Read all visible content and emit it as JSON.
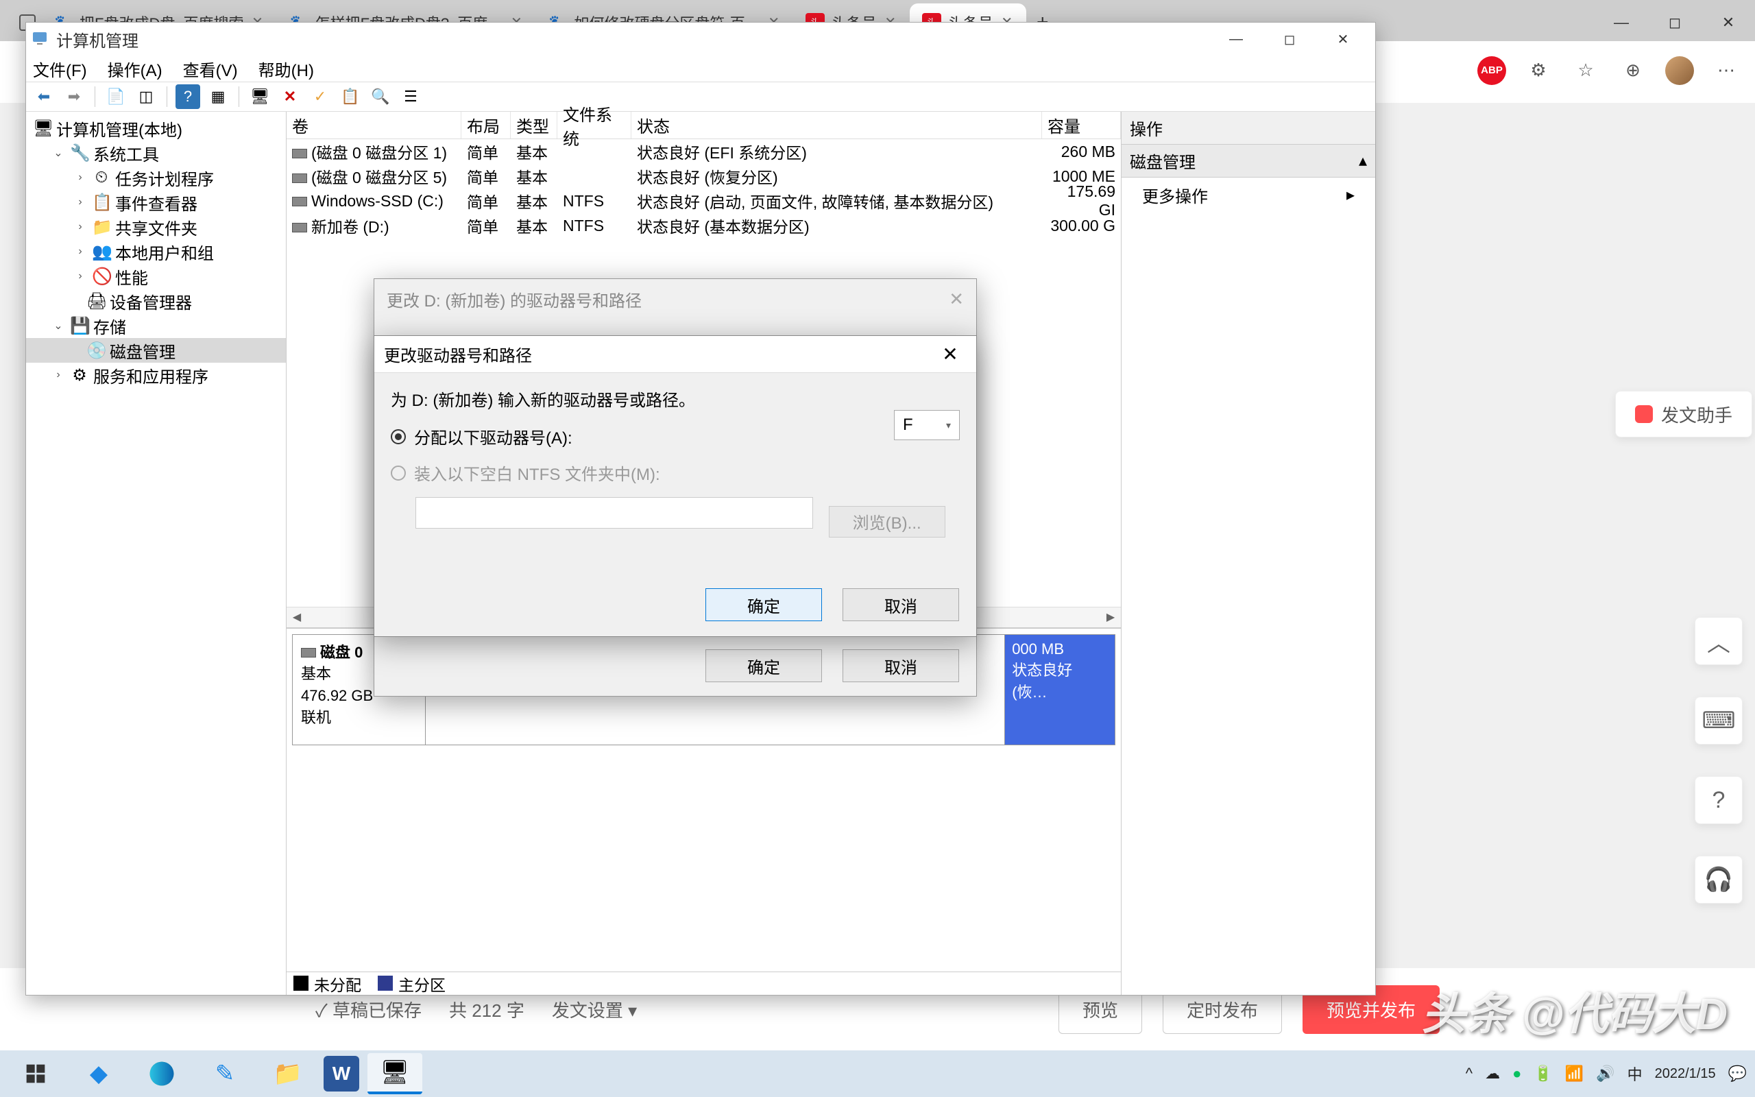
{
  "browser": {
    "tabs": [
      {
        "title": "把F盘改成D盘_百度搜索",
        "favicon": "🐾"
      },
      {
        "title": "怎样把F盘改成D盘?_百度…",
        "favicon": "🐾"
      },
      {
        "title": "如何修改硬盘分区盘符-百…",
        "favicon": "🐾"
      },
      {
        "title": "头条号",
        "favicon": "头"
      },
      {
        "title": "头条号",
        "favicon": "头",
        "active": true
      }
    ],
    "new_tab": "+"
  },
  "window_controls_browser": {
    "min": "—",
    "max": "◻",
    "close": "✕"
  },
  "toolbar_icons": {
    "adblock": "ABP",
    "more": "⋯"
  },
  "mmc": {
    "title": "计算机管理",
    "menus": [
      "文件(F)",
      "操作(A)",
      "查看(V)",
      "帮助(H)"
    ],
    "window_controls": {
      "min": "—",
      "max": "◻",
      "close": "✕"
    },
    "tree": {
      "root": "计算机管理(本地)",
      "system_tools": "系统工具",
      "items": [
        "任务计划程序",
        "事件查看器",
        "共享文件夹",
        "本地用户和组",
        "性能",
        "设备管理器"
      ],
      "storage": "存储",
      "disk_mgmt": "磁盘管理",
      "services": "服务和应用程序"
    },
    "columns": {
      "vol": "卷",
      "layout": "布局",
      "type": "类型",
      "fs": "文件系统",
      "status": "状态",
      "cap": "容量"
    },
    "rows": [
      {
        "vol": "(磁盘 0 磁盘分区 1)",
        "layout": "简单",
        "type": "基本",
        "fs": "",
        "status": "状态良好 (EFI 系统分区)",
        "cap": "260 MB"
      },
      {
        "vol": "(磁盘 0 磁盘分区 5)",
        "layout": "简单",
        "type": "基本",
        "fs": "",
        "status": "状态良好 (恢复分区)",
        "cap": "1000 ME"
      },
      {
        "vol": "Windows-SSD (C:)",
        "layout": "简单",
        "type": "基本",
        "fs": "NTFS",
        "status": "状态良好 (启动, 页面文件, 故障转储, 基本数据分区)",
        "cap": "175.69 GI"
      },
      {
        "vol": "新加卷 (D:)",
        "layout": "简单",
        "type": "基本",
        "fs": "NTFS",
        "status": "状态良好 (基本数据分区)",
        "cap": "300.00 G"
      }
    ],
    "disk": {
      "title": "磁盘 0",
      "type": "基本",
      "size": "476.92 GB",
      "status": "联机"
    },
    "partition_peek": {
      "size": "000 MB",
      "status": "状态良好 (恢…"
    },
    "legend": {
      "unalloc": "未分配",
      "primary": "主分区"
    },
    "right": {
      "header": "操作",
      "section": "磁盘管理",
      "item": "更多操作"
    }
  },
  "dialog1": {
    "title": "更改 D: (新加卷) 的驱动器号和路径",
    "ok": "确定",
    "cancel": "取消"
  },
  "dialog2": {
    "title": "更改驱动器号和路径",
    "prompt": "为 D: (新加卷) 输入新的驱动器号或路径。",
    "opt_assign": "分配以下驱动器号(A):",
    "opt_mount": "装入以下空白 NTFS 文件夹中(M):",
    "drive_letter": "F",
    "browse": "浏览(B)...",
    "ok": "确定",
    "cancel": "取消"
  },
  "editor": {
    "draft_saved": "草稿已保存",
    "word_count": "共 212 字",
    "settings": "发文设置",
    "preview": "预览",
    "schedule": "定时发布",
    "publish": "预览并发布"
  },
  "float": {
    "assistant": "发文助手",
    "up": "︿"
  },
  "taskbar": {
    "ime": "中",
    "time": "2022/1/15"
  },
  "watermark": "头条 @代码大D"
}
